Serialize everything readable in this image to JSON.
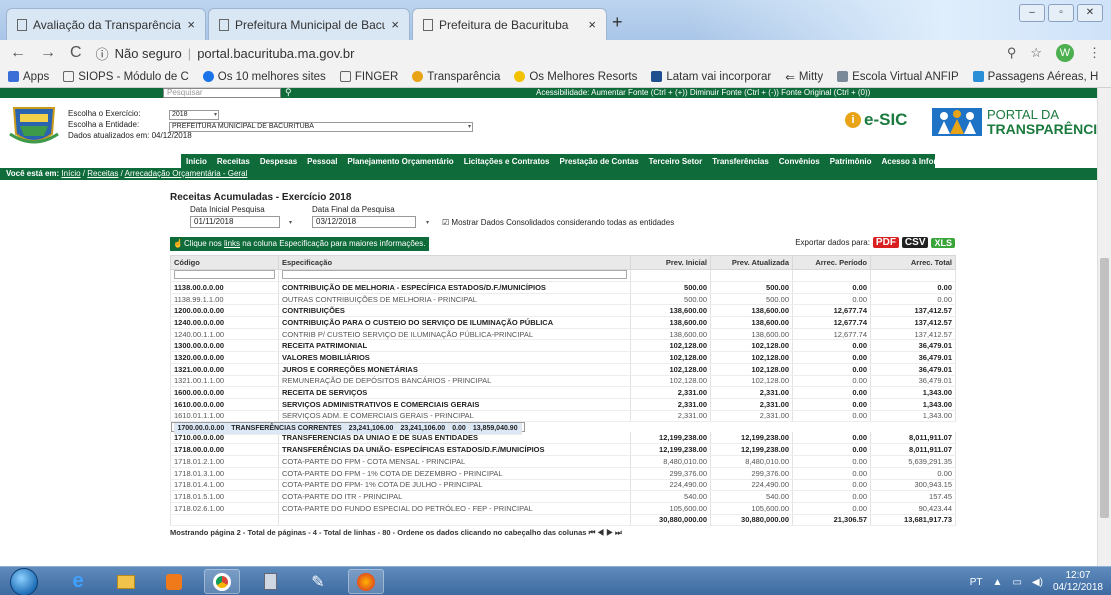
{
  "browser": {
    "tabs": [
      {
        "label": "Avaliação da Transparência dos",
        "active": false
      },
      {
        "label": "Prefeitura Municipal de Bacurituba",
        "active": false
      },
      {
        "label": "Prefeitura de Bacurituba",
        "active": true
      }
    ],
    "security": "Não seguro",
    "url": "portal.bacurituba.ma.gov.br",
    "avatar_letter": "W",
    "bookmarks": [
      "Apps",
      "SIOPS - Módulo de C",
      "Os 10 melhores sites",
      "FINGER",
      "Transparência",
      "Os Melhores Resorts",
      "Latam vai incorporar",
      "Mitty",
      "Escola Virtual ANFIP",
      "Passagens Aéreas, H"
    ],
    "bookmarks_more": "»"
  },
  "portal": {
    "search_placeholder": "Pesquisar",
    "accessibility": "Acessibilidade:   Aumentar Fonte (Ctrl + (+))   Diminuir Fonte (Ctrl + (-))   Fonte Original (Ctrl + (0))",
    "label_exercicio": "Escolha o Exercício:",
    "label_entidade": "Escolha a Entidade:",
    "label_atualizado": "Dados atualizados em: 04/12/2018",
    "exercicio": "2018",
    "entidade": "PREFEITURA MUNICIPAL DE BACURITUBA",
    "esic": "e-SIC",
    "portal_a": "PORTAL DA",
    "portal_b": "TRANSPARÊNCIA",
    "menu": [
      "Início",
      "Receitas",
      "Despesas",
      "Pessoal",
      "Planejamento Orçamentário",
      "Licitações e Contratos",
      "Prestação de Contas",
      "Terceiro Setor",
      "Transferências",
      "Convênios",
      "Patrimônio",
      "Acesso à Informação"
    ],
    "breadcrumb_prefix": "Você está em:",
    "breadcrumb": [
      "Início",
      "Receitas",
      "Arrecadação Orçamentária - Geral"
    ]
  },
  "report": {
    "title": "Receitas Acumuladas - Exercício 2018",
    "date_start_label": "Data Inicial Pesquisa",
    "date_end_label": "Data Final da Pesquisa",
    "date_start": "01/11/2018",
    "date_end": "03/12/2018",
    "consolidated_label": "Mostrar Dados Consolidados considerando todas as entidades",
    "info_pre": "Clique nos ",
    "info_link": "links",
    "info_post": " na coluna Especificação para maiores informações.",
    "export_label": "Exportar dados para:",
    "export_pdf": "PDF",
    "export_csv": "CSV",
    "export_xls": "XLS",
    "columns": [
      "Código",
      "Especificação",
      "Prev. Inicial",
      "Prev. Atualizada",
      "Arrec. Período",
      "Arrec. Total"
    ],
    "rows": [
      {
        "c": "1138.00.0.0.00",
        "e": "CONTRIBUIÇÃO DE MELHORIA - ESPECÍFICA ESTADOS/D.F./MUNICÍPIOS",
        "pi": "500.00",
        "pa": "500.00",
        "ap": "0.00",
        "at": "0.00",
        "bold": true
      },
      {
        "c": "1138.99.1.1.00",
        "e": "OUTRAS CONTRIBUIÇÕES DE MELHORIA - PRINCIPAL",
        "pi": "500.00",
        "pa": "500.00",
        "ap": "0.00",
        "at": "0.00",
        "bold": false
      },
      {
        "c": "1200.00.0.0.00",
        "e": "CONTRIBUIÇÕES",
        "pi": "138,600.00",
        "pa": "138,600.00",
        "ap": "12,677.74",
        "at": "137,412.57",
        "bold": true
      },
      {
        "c": "1240.00.0.0.00",
        "e": "CONTRIBUIÇÃO PARA O CUSTEIO DO SERVIÇO DE ILUMINAÇÃO PÚBLICA",
        "pi": "138,600.00",
        "pa": "138,600.00",
        "ap": "12,677.74",
        "at": "137,412.57",
        "bold": true
      },
      {
        "c": "1240.00.1.1.00",
        "e": "CONTRIB P/ CUSTEIO SERVIÇO DE ILUMINAÇÃO PÚBLICA-PRINCIPAL",
        "pi": "138,600.00",
        "pa": "138,600.00",
        "ap": "12,677.74",
        "at": "137,412.57",
        "bold": false
      },
      {
        "c": "1300.00.0.0.00",
        "e": "RECEITA PATRIMONIAL",
        "pi": "102,128.00",
        "pa": "102,128.00",
        "ap": "0.00",
        "at": "36,479.01",
        "bold": true
      },
      {
        "c": "1320.00.0.0.00",
        "e": "VALORES MOBILIÁRIOS",
        "pi": "102,128.00",
        "pa": "102,128.00",
        "ap": "0.00",
        "at": "36,479.01",
        "bold": true
      },
      {
        "c": "1321.00.0.0.00",
        "e": "JUROS E CORREÇÕES MONETÁRIAS",
        "pi": "102,128.00",
        "pa": "102,128.00",
        "ap": "0.00",
        "at": "36,479.01",
        "bold": true
      },
      {
        "c": "1321.00.1.1.00",
        "e": "REMUNERAÇÃO DE DEPÓSITOS BANCÁRIOS - PRINCIPAL",
        "pi": "102,128.00",
        "pa": "102,128.00",
        "ap": "0.00",
        "at": "36,479.01",
        "bold": false
      },
      {
        "c": "1600.00.0.0.00",
        "e": "RECEITA DE SERVIÇOS",
        "pi": "2,331.00",
        "pa": "2,331.00",
        "ap": "0.00",
        "at": "1,343.00",
        "bold": true
      },
      {
        "c": "1610.00.0.0.00",
        "e": "SERVIÇOS ADMINISTRATIVOS E COMERCIAIS GERAIS",
        "pi": "2,331.00",
        "pa": "2,331.00",
        "ap": "0.00",
        "at": "1,343.00",
        "bold": true
      },
      {
        "c": "1610.01.1.1.00",
        "e": "SERVIÇOS ADM. E COMERCIAIS GERAIS - PRINCIPAL",
        "pi": "2,331.00",
        "pa": "2,331.00",
        "ap": "0.00",
        "at": "1,343.00",
        "bold": false
      },
      {
        "c": "1700.00.0.0.00",
        "e": "TRANSFERÊNCIAS CORRENTES",
        "pi": "23,241,106.00",
        "pa": "23,241,106.00",
        "ap": "0.00",
        "at": "13,859,040.90",
        "bold": true,
        "selected": true
      },
      {
        "c": "1710.00.0.0.00",
        "e": "TRANSFERÊNCIAS DA UNIÃO E DE SUAS ENTIDADES",
        "pi": "12,199,238.00",
        "pa": "12,199,238.00",
        "ap": "0.00",
        "at": "8,011,911.07",
        "bold": true
      },
      {
        "c": "1718.00.0.0.00",
        "e": "TRANSFERÊNCIAS DA UNIÃO- ESPECÍFICAS ESTADOS/D.F./MUNICÍPIOS",
        "pi": "12,199,238.00",
        "pa": "12,199,238.00",
        "ap": "0.00",
        "at": "8,011,911.07",
        "bold": true
      },
      {
        "c": "1718.01.2.1.00",
        "e": "COTA-PARTE DO FPM - COTA MENSAL - PRINCIPAL",
        "pi": "8,480,010.00",
        "pa": "8,480,010.00",
        "ap": "0.00",
        "at": "5,639,291.35",
        "bold": false
      },
      {
        "c": "1718.01.3.1.00",
        "e": "COTA-PARTE DO FPM - 1% COTA DE DEZEMBRO - PRINCIPAL",
        "pi": "299,376.00",
        "pa": "299,376.00",
        "ap": "0.00",
        "at": "0.00",
        "bold": false
      },
      {
        "c": "1718.01.4.1.00",
        "e": "COTA-PARTE DO FPM- 1% COTA DE JULHO - PRINCIPAL",
        "pi": "224,490.00",
        "pa": "224,490.00",
        "ap": "0.00",
        "at": "300,943.15",
        "bold": false
      },
      {
        "c": "1718.01.5.1.00",
        "e": "COTA-PARTE DO ITR - PRINCIPAL",
        "pi": "540.00",
        "pa": "540.00",
        "ap": "0.00",
        "at": "157.45",
        "bold": false
      },
      {
        "c": "1718.02.6.1.00",
        "e": "COTA-PARTE DO FUNDO ESPECIAL DO PETRÓLEO - FEP - PRINCIPAL",
        "pi": "105,600.00",
        "pa": "105,600.00",
        "ap": "0.00",
        "at": "90,423.44",
        "bold": false
      }
    ],
    "totals": {
      "pi": "30,880,000.00",
      "pa": "30,880,000.00",
      "ap": "21,306.57",
      "at": "13,681,917.73"
    },
    "pager": "Mostrando página 2 - Total de páginas - 4 - Total de linhas - 80 - Ordene os dados clicando no cabeçalho das colunas"
  },
  "taskbar": {
    "lang": "PT",
    "time": "12:07",
    "date": "04/12/2018"
  },
  "colors": {
    "portal_green": "#0f6b3a",
    "pdf": "#d92121",
    "xls": "#3aa539"
  }
}
